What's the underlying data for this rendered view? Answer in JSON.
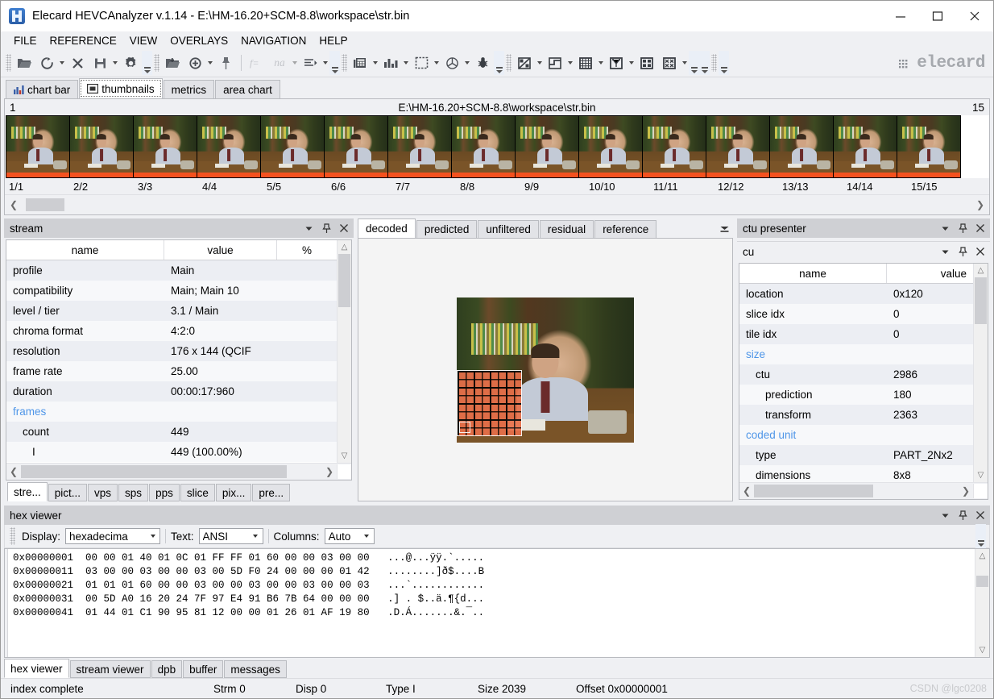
{
  "window": {
    "title": "Elecard HEVCAnalyzer v.1.14 - E:\\HM-16.20+SCM-8.8\\workspace\\str.bin",
    "minimize": "–",
    "maximize": "□",
    "close": "✕"
  },
  "menu": [
    "FILE",
    "REFERENCE",
    "VIEW",
    "OVERLAYS",
    "NAVIGATION",
    "HELP"
  ],
  "toolbar": {
    "brand": "elecard",
    "na_label": "na",
    "fx_label": "f="
  },
  "top_tabs": [
    {
      "label": "chart bar",
      "icon": "bar-chart-icon",
      "active": false
    },
    {
      "label": "thumbnails",
      "icon": "filmstrip-icon",
      "active": true
    },
    {
      "label": "metrics",
      "icon": "",
      "active": false
    },
    {
      "label": "area chart",
      "icon": "",
      "active": false
    }
  ],
  "thumbnails": {
    "start_index": "1",
    "end_index": "15",
    "path": "E:\\HM-16.20+SCM-8.8\\workspace\\str.bin",
    "labels": [
      "1/1",
      "2/2",
      "3/3",
      "4/4",
      "5/5",
      "6/6",
      "7/7",
      "8/8",
      "9/9",
      "10/10",
      "11/11",
      "12/12",
      "13/13",
      "14/14",
      "15/15"
    ],
    "marker_color": "#f4511e"
  },
  "stream_panel": {
    "caption": "stream",
    "columns": [
      "name",
      "value",
      "%"
    ],
    "rows": [
      {
        "name": "profile",
        "value": "Main",
        "pct": "",
        "indent": 0,
        "group": false
      },
      {
        "name": "compatibility",
        "value": "Main; Main 10",
        "pct": "",
        "indent": 0,
        "group": false
      },
      {
        "name": "level / tier",
        "value": "3.1 / Main",
        "pct": "",
        "indent": 0,
        "group": false
      },
      {
        "name": "chroma format",
        "value": "4:2:0",
        "pct": "",
        "indent": 0,
        "group": false
      },
      {
        "name": "resolution",
        "value": "176 x 144 (QCIF",
        "pct": "",
        "indent": 0,
        "group": false
      },
      {
        "name": "frame rate",
        "value": "25.00",
        "pct": "",
        "indent": 0,
        "group": false
      },
      {
        "name": "duration",
        "value": "00:00:17:960",
        "pct": "",
        "indent": 0,
        "group": false
      },
      {
        "name": "frames",
        "value": "",
        "pct": "",
        "indent": 0,
        "group": true
      },
      {
        "name": "count",
        "value": "449",
        "pct": "",
        "indent": 1,
        "group": false
      },
      {
        "name": "I",
        "value": "449 (100.00%)",
        "pct": "100",
        "indent": 2,
        "group": false
      }
    ],
    "tabs": [
      "stre...",
      "pict...",
      "vps",
      "sps",
      "pps",
      "slice",
      "pix...",
      "pre..."
    ],
    "active_tab": "stre..."
  },
  "viewer": {
    "tabs": [
      "decoded",
      "predicted",
      "unfiltered",
      "residual",
      "reference"
    ],
    "active_tab": "decoded"
  },
  "ctu_presenter": {
    "caption": "ctu presenter"
  },
  "cu_panel": {
    "caption": "cu",
    "columns": [
      "name",
      "value"
    ],
    "rows": [
      {
        "name": "location",
        "value": "0x120",
        "indent": 0,
        "group": false
      },
      {
        "name": "slice idx",
        "value": "0",
        "indent": 0,
        "group": false
      },
      {
        "name": "tile idx",
        "value": "0",
        "indent": 0,
        "group": false
      },
      {
        "name": "size",
        "value": "",
        "indent": 0,
        "group": true
      },
      {
        "name": "ctu",
        "value": "2986",
        "indent": 1,
        "group": false
      },
      {
        "name": "prediction",
        "value": "180",
        "indent": 2,
        "group": false
      },
      {
        "name": "transform",
        "value": "2363",
        "indent": 2,
        "group": false
      },
      {
        "name": "coded unit",
        "value": "",
        "indent": 0,
        "group": true
      },
      {
        "name": "type",
        "value": "PART_2Nx2",
        "indent": 1,
        "group": false
      },
      {
        "name": "dimensions",
        "value": "8x8",
        "indent": 1,
        "group": false
      }
    ]
  },
  "hex_viewer": {
    "caption": "hex viewer",
    "display_label": "Display:",
    "display_value": "hexadecima",
    "text_label": "Text:",
    "text_value": "ANSI",
    "columns_label": "Columns:",
    "columns_value": "Auto",
    "lines": [
      {
        "offset": "0x00000001",
        "bytes": "00 00 01 40 01 0C 01 FF FF 01 60 00 00 03 00 00",
        "ascii": "...@...ÿÿ.`....."
      },
      {
        "offset": "0x00000011",
        "bytes": "03 00 00 03 00 00 03 00 5D F0 24 00 00 00 01 42",
        "ascii": "........]ð$....B"
      },
      {
        "offset": "0x00000021",
        "bytes": "01 01 01 60 00 00 03 00 00 03 00 00 03 00 00 03",
        "ascii": "...`............"
      },
      {
        "offset": "0x00000031",
        "bytes": "00 5D A0 16 20 24 7F 97 E4 91 B6 7B 64 00 00 00",
        "ascii": ".] . $..ä.¶{d..."
      },
      {
        "offset": "0x00000041",
        "bytes": "01 44 01 C1 90 95 81 12 00 00 01 26 01 AF 19 80",
        "ascii": ".D.Á.......&.¯.."
      }
    ]
  },
  "bottom_tabs": [
    "hex viewer",
    "stream viewer",
    "dpb",
    "buffer",
    "messages"
  ],
  "bottom_active_tab": "hex viewer",
  "statusbar": {
    "message": "index complete",
    "stream": "Strm 0",
    "display": "Disp 0",
    "type": "Type I",
    "size": "Size 2039",
    "offset": "Offset 0x00000001",
    "watermark": "CSDN @lgc0208"
  }
}
